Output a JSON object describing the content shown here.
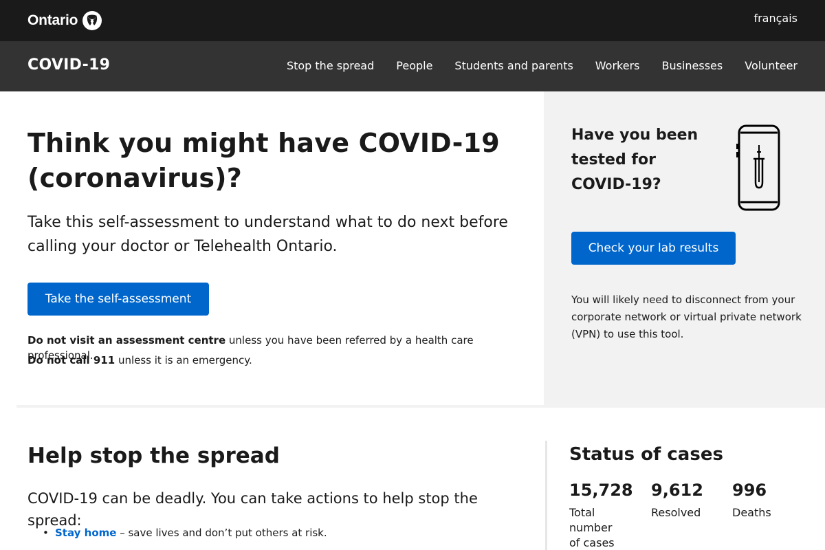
{
  "header": {
    "logo_text": "Ontario",
    "language_link": "français"
  },
  "nav": {
    "site_title": "COVID-19",
    "links": [
      "Stop the spread",
      "People",
      "Students and parents",
      "Workers",
      "Businesses",
      "Volunteer"
    ]
  },
  "hero": {
    "title": "Think you might have COVID-19 (coronavirus)?",
    "intro": "Take this self-assessment to understand what to do next before calling your doctor or Telehealth Ontario.",
    "button_label": "Take the self-assessment",
    "warning_1_bold": "Do not visit an assessment centre",
    "warning_1_rest": " unless you have been referred by a health care professional.",
    "warning_2_bold": "Do not call 911",
    "warning_2_rest": " unless it is an emergency."
  },
  "testing": {
    "heading": "Have you been tested for COVID-19?",
    "button_label": "Check your lab results",
    "note": "You will likely need to disconnect from your corporate network or virtual private network (VPN) to use this tool."
  },
  "spread": {
    "heading": "Help stop the spread",
    "intro": "COVID-19 can be deadly. You can take actions to help stop the spread:",
    "items": [
      {
        "link": "Stay home",
        "text": " – save lives and don’t put others at risk."
      }
    ]
  },
  "status": {
    "heading": "Status of cases",
    "stats": [
      {
        "value": "15,728",
        "label": "Total number of cases"
      },
      {
        "value": "9,612",
        "label": "Resolved"
      },
      {
        "value": "996",
        "label": "Deaths"
      }
    ]
  },
  "colors": {
    "topbar": "#1a1a1a",
    "navbar": "#333333",
    "button": "#0066cc",
    "link": "#0066cc",
    "panel": "#f2f2f2"
  },
  "icons": [
    "ontario-trillium-logo-icon",
    "lab-test-phone-icon"
  ]
}
